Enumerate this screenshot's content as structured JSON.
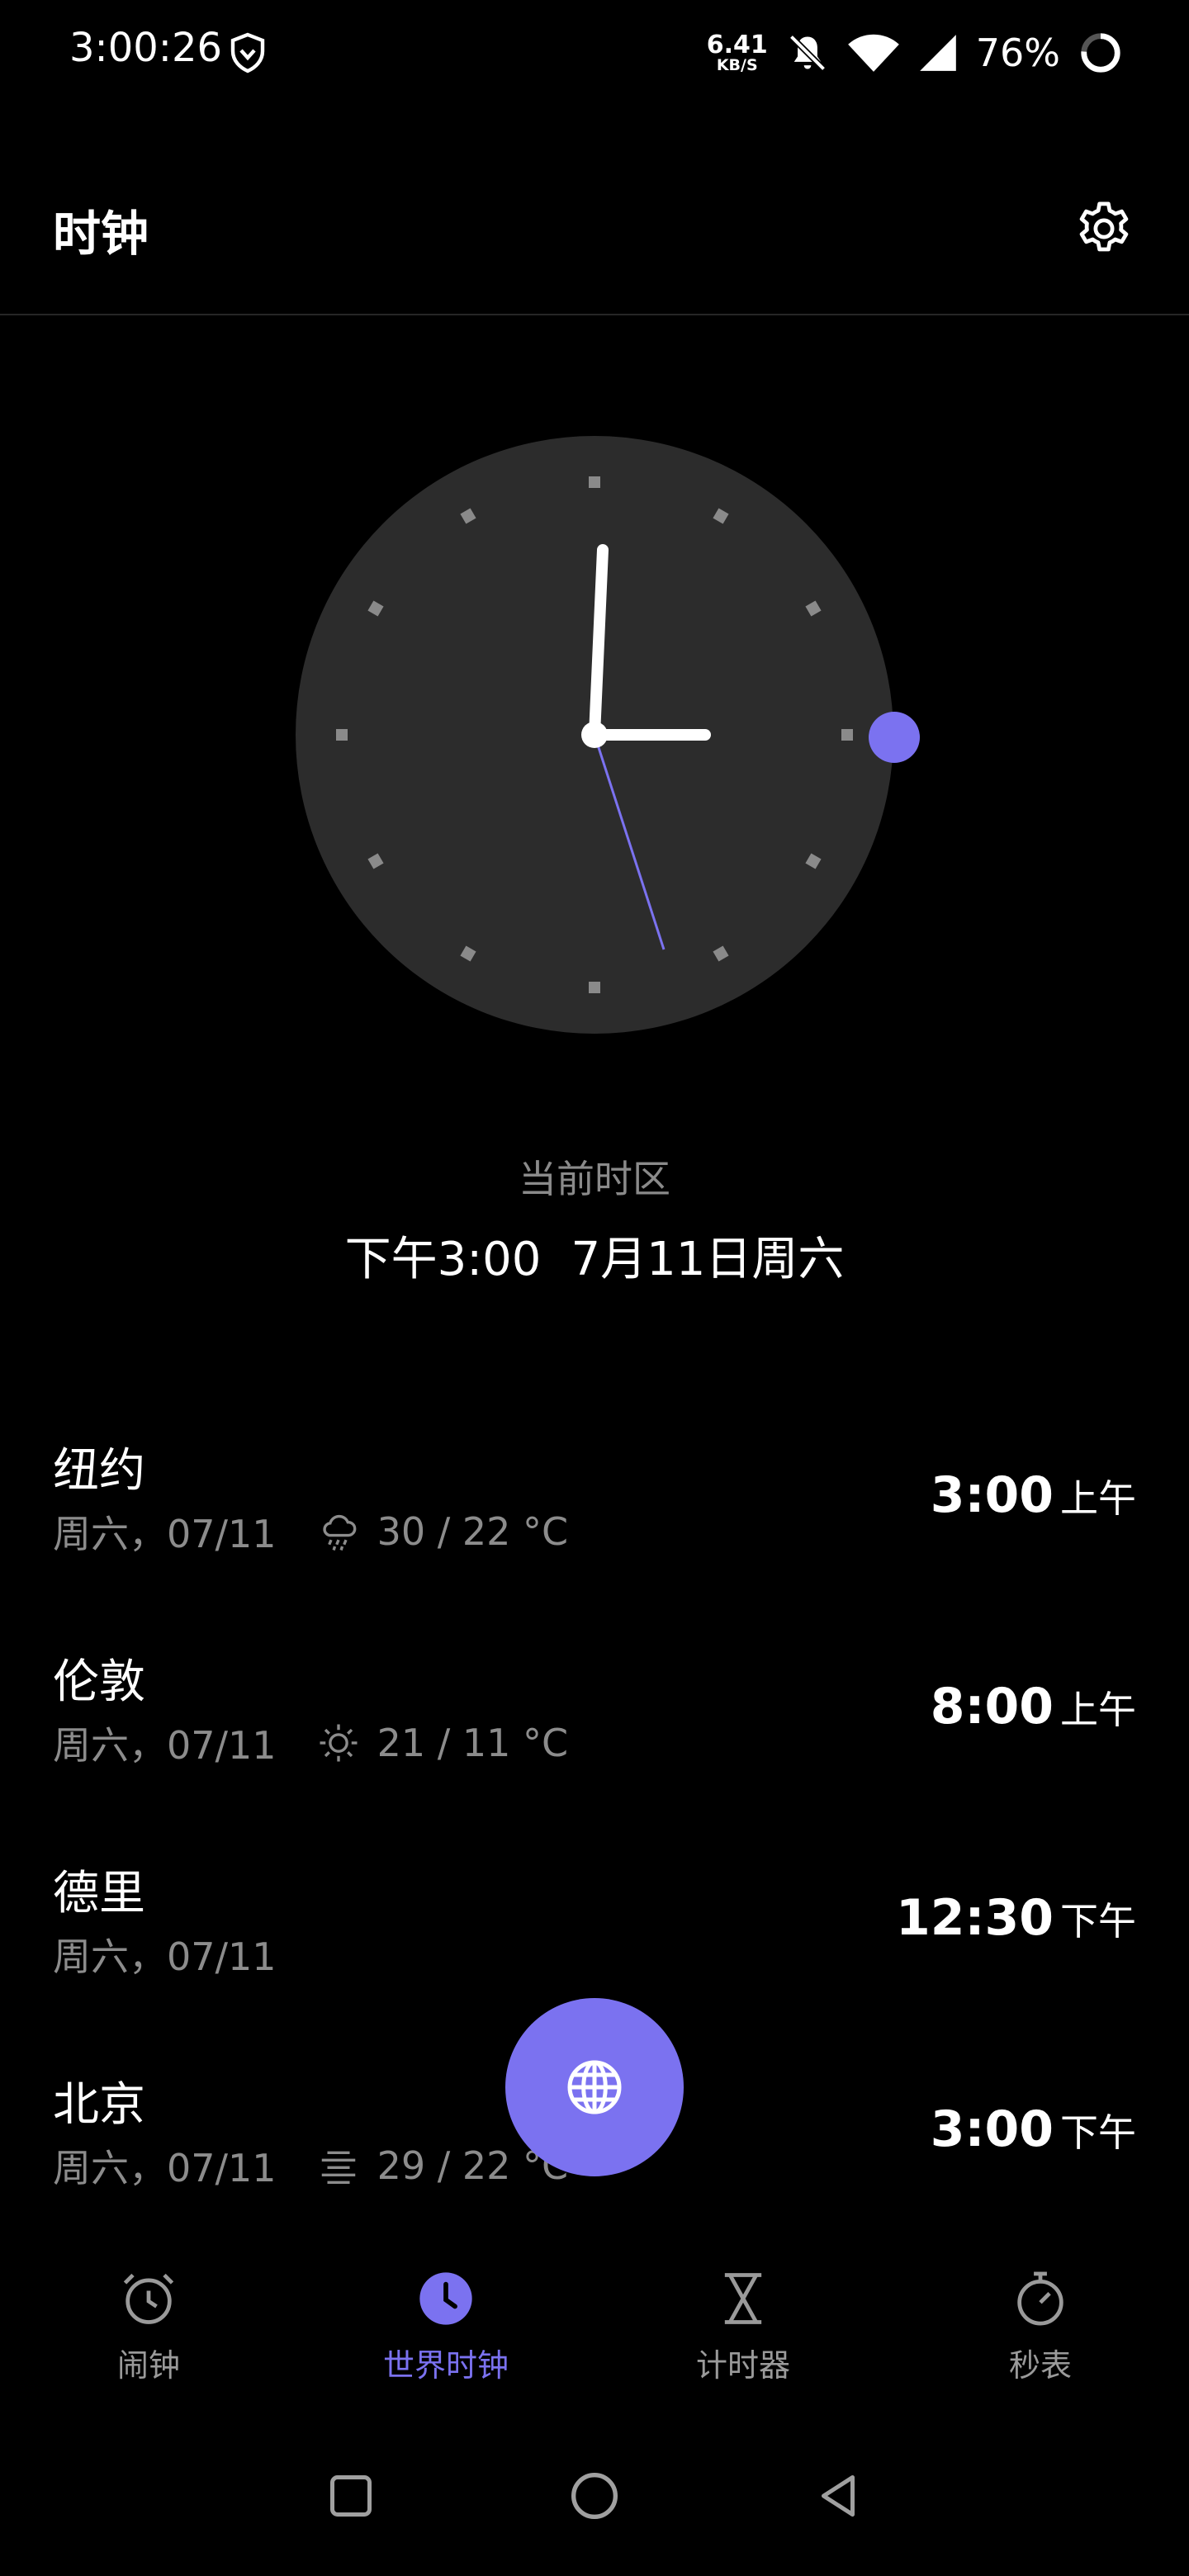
{
  "status_bar": {
    "time": "3:00:26",
    "net_speed_value": "6.41",
    "net_speed_unit": "KB/S",
    "battery": "76%"
  },
  "app_bar": {
    "title": "时钟"
  },
  "current_zone": {
    "label": "当前时区",
    "time": "下午3:00",
    "date": "7月11日周六"
  },
  "cities": [
    {
      "name": "纽约",
      "date": "周六，07/11",
      "weather_icon": "rain-cloud-icon",
      "temp": "30 / 22 °C",
      "time": "3:00",
      "ampm": "上午"
    },
    {
      "name": "伦敦",
      "date": "周六，07/11",
      "weather_icon": "sun-icon",
      "temp": "21 / 11 °C",
      "time": "8:00",
      "ampm": "上午"
    },
    {
      "name": "德里",
      "date": "周六，07/11",
      "weather_icon": "",
      "temp": "",
      "time": "12:30",
      "ampm": "下午"
    },
    {
      "name": "北京",
      "date": "周六，07/11",
      "weather_icon": "haze-icon",
      "temp": "29 / 22 °C",
      "time": "3:00",
      "ampm": "下午"
    }
  ],
  "bottom_nav": [
    {
      "label": "闹钟",
      "icon": "alarm-icon",
      "active": false
    },
    {
      "label": "世界时钟",
      "icon": "world-clock-icon",
      "active": true
    },
    {
      "label": "计时器",
      "icon": "hourglass-icon",
      "active": false
    },
    {
      "label": "秒表",
      "icon": "stopwatch-icon",
      "active": false
    }
  ],
  "colors": {
    "accent": "#7b72f0",
    "background": "#000000",
    "clock_face": "#2c2c2c",
    "secondary_text": "#8c8c8c"
  }
}
